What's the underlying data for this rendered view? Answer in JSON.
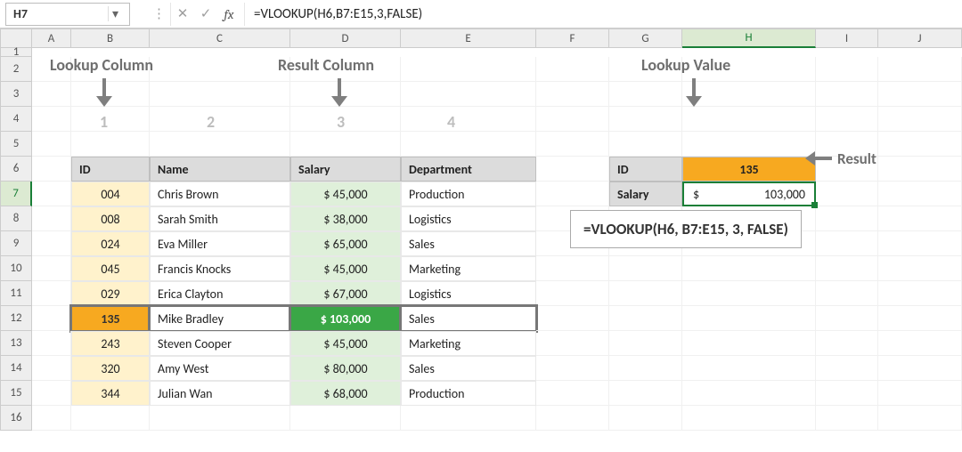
{
  "formula_bar": {
    "cell_ref": "H7",
    "fx_label": "fx",
    "formula": "=VLOOKUP(H6,B7:E15,3,FALSE)",
    "cancel_icon": "✕",
    "accept_icon": "✓",
    "dropdown_icon": "▾",
    "options_icon": "⋮"
  },
  "columns": [
    "A",
    "B",
    "C",
    "D",
    "E",
    "F",
    "G",
    "H",
    "I",
    "J"
  ],
  "rows": [
    "1",
    "2",
    "3",
    "4",
    "5",
    "6",
    "7",
    "8",
    "9",
    "10",
    "11",
    "12",
    "13",
    "14",
    "15",
    "16"
  ],
  "labels": {
    "lookup_column": "Lookup Column",
    "result_column": "Result Column",
    "lookup_value": "Lookup Value",
    "result": "Result"
  },
  "col_numbers": [
    "1",
    "2",
    "3",
    "4"
  ],
  "table": {
    "headers": {
      "id": "ID",
      "name": "Name",
      "salary": "Salary",
      "department": "Department"
    },
    "rows": [
      {
        "id": "004",
        "name": "Chris Brown",
        "salary": "$  45,000",
        "department": "Production"
      },
      {
        "id": "008",
        "name": "Sarah Smith",
        "salary": "$  38,000",
        "department": "Logistics"
      },
      {
        "id": "024",
        "name": "Eva Miller",
        "salary": "$  65,000",
        "department": "Sales"
      },
      {
        "id": "045",
        "name": "Francis Knocks",
        "salary": "$  45,000",
        "department": "Marketing"
      },
      {
        "id": "029",
        "name": "Erica Clayton",
        "salary": "$  67,000",
        "department": "Logistics"
      },
      {
        "id": "135",
        "name": "Mike Bradley",
        "salary": "$ 103,000",
        "department": "Sales"
      },
      {
        "id": "243",
        "name": "Steven Cooper",
        "salary": "$  45,000",
        "department": "Marketing"
      },
      {
        "id": "320",
        "name": "Amy West",
        "salary": "$  80,000",
        "department": "Sales"
      },
      {
        "id": "344",
        "name": "Julian Wan",
        "salary": "$  68,000",
        "department": "Production"
      }
    ],
    "highlight_index": 5
  },
  "lookup_box": {
    "id_label": "ID",
    "id_value": "135",
    "salary_label": "Salary",
    "salary_value_currency": "$",
    "salary_value": "103,000"
  },
  "formula_display": "=VLOOKUP(H6, B7:E15, 3, FALSE)",
  "colors": {
    "accent_green": "#1a7f37",
    "orange": "#f7a920",
    "light_green": "#dff0da",
    "light_yellow": "#fff2cc",
    "header_gray": "#dcdcdc"
  }
}
